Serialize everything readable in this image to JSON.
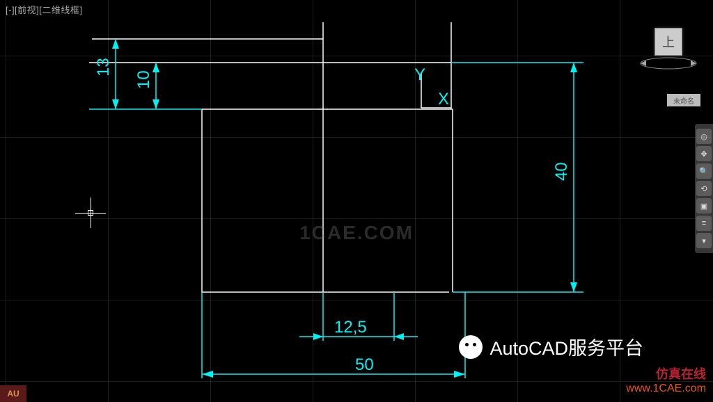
{
  "viewLabel": "[-][前视][二维线框]",
  "watermark": {
    "center": "1CAE.COM",
    "line1": "仿真在线",
    "line2": "www.1CAE.com"
  },
  "wechat": "AutoCAD服务平台",
  "viewcube": {
    "face": "上"
  },
  "navBadge": "未命名",
  "axes": {
    "x": "X",
    "y": "Y"
  },
  "logo": "AU",
  "dimensions": {
    "d13": "13",
    "d10": "10",
    "d40": "40",
    "d12_5": "12,5",
    "d50": "50"
  },
  "toolbar": {
    "items": [
      "wheel",
      "pan",
      "zoom",
      "orbit",
      "show",
      "settings",
      "arrow"
    ]
  }
}
